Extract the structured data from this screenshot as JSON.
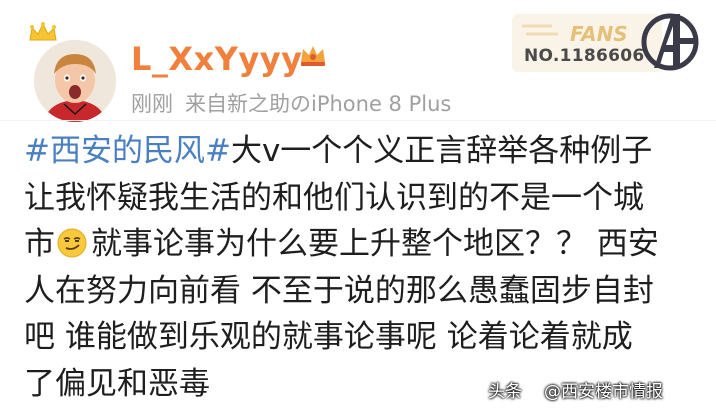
{
  "post": {
    "username": "L_XxYyyy-",
    "time": "刚刚",
    "source": "来自新之助のiPhone 8 Plus",
    "fans_card": {
      "label": "FANS",
      "number": "NO.1186606"
    },
    "lines": [
      {
        "hashtag": "#西安的民风#",
        "text": "大v一个个义正言辞举各种例子"
      },
      {
        "text": "让我怀疑我生活的和他们认识到的不是一个城"
      },
      {
        "text_before": "市",
        "emoji": "smirk-emoji",
        "text_after": "就事论事为什么要上升整个地区？？ 西安"
      },
      {
        "text": "人在努力向前看 不至于说的那么愚蠢固步自封"
      },
      {
        "text": "吧 谁能做到乐观的就事论事呢 论着论着就成"
      },
      {
        "text": "了偏见和恶毒"
      }
    ]
  },
  "watermark": {
    "prefix": "头条",
    "account": "@西安楼市情报"
  },
  "colors": {
    "username": "#f0803c",
    "meta": "#a0a0a0",
    "hashtag": "#4a7fc1",
    "body_text": "#1e1e1e"
  },
  "icons": [
    "crown-icon",
    "avatar",
    "vip-badge-icon",
    "avengers-logo-icon",
    "smirk-emoji",
    "watermark-icon"
  ]
}
